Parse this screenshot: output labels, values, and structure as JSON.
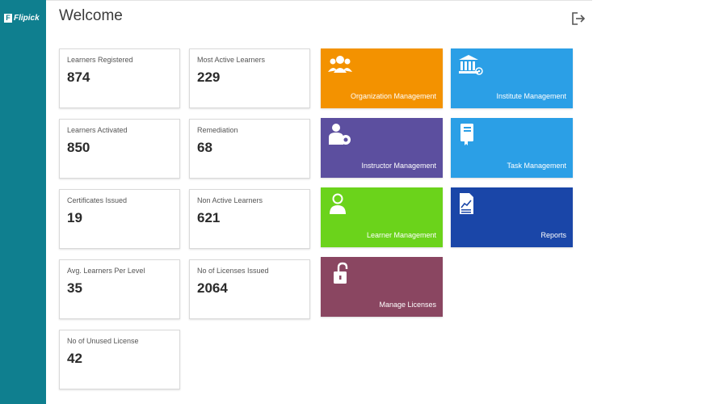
{
  "app": {
    "logo_text": "Flipick",
    "logo_mark": "F"
  },
  "header": {
    "title": "Welcome"
  },
  "stats": [
    {
      "label": "Learners Registered",
      "value": "874"
    },
    {
      "label": "Most Active Learners",
      "value": "229"
    },
    {
      "label": "Learners Activated",
      "value": "850"
    },
    {
      "label": "Remediation",
      "value": "68"
    },
    {
      "label": "Certificates Issued",
      "value": "19"
    },
    {
      "label": "Non Active Learners",
      "value": "621"
    },
    {
      "label": "Avg. Learners Per Level",
      "value": "35"
    },
    {
      "label": "No of Licenses Issued",
      "value": "2064"
    },
    {
      "label": "No of Unused License",
      "value": "42"
    }
  ],
  "tiles": [
    {
      "label": "Organization Management",
      "color": "#f39200",
      "icon": "users-group-icon"
    },
    {
      "label": "Institute Management",
      "color": "#2b9fe6",
      "icon": "institute-building-icon"
    },
    {
      "label": "Instructor Management",
      "color": "#5c4f9f",
      "icon": "instructor-icon"
    },
    {
      "label": "Task Management",
      "color": "#2b9fe6",
      "icon": "task-book-icon"
    },
    {
      "label": "Learner Management",
      "color": "#6bd31b",
      "icon": "learner-icon"
    },
    {
      "label": "Reports",
      "color": "#1a46a8",
      "icon": "report-chart-icon"
    },
    {
      "label": "Manage Licenses",
      "color": "#8a4661",
      "icon": "padlock-icon"
    }
  ],
  "colors": {
    "sidebar": "#0f7f8f",
    "title_text": "#3a3a3a"
  }
}
